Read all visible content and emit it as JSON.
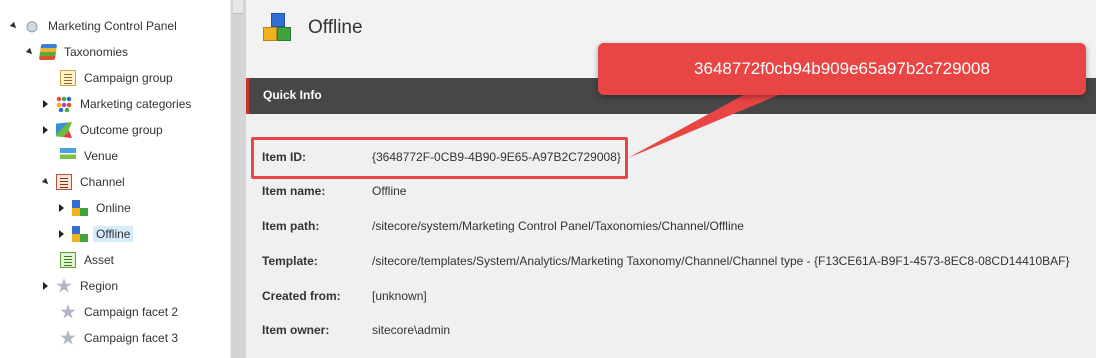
{
  "tree": {
    "items": [
      {
        "label": "Marketing Control Panel",
        "icon": "control-panel-icon"
      },
      {
        "label": "Taxonomies",
        "icon": "books-icon"
      },
      {
        "label": "Campaign group",
        "icon": "document-icon"
      },
      {
        "label": "Marketing categories",
        "icon": "dots-icon"
      },
      {
        "label": "Outcome group",
        "icon": "flag-icon"
      },
      {
        "label": "Venue",
        "icon": "signpost-icon"
      },
      {
        "label": "Channel",
        "icon": "document-icon"
      },
      {
        "label": "Online",
        "icon": "cubes-icon"
      },
      {
        "label": "Offline",
        "icon": "cubes-icon"
      },
      {
        "label": "Asset",
        "icon": "document-icon"
      },
      {
        "label": "Region",
        "icon": "star-icon"
      },
      {
        "label": "Campaign facet 2",
        "icon": "star-icon"
      },
      {
        "label": "Campaign facet 3",
        "icon": "star-icon"
      }
    ],
    "selected": "Offline"
  },
  "item": {
    "title": "Offline",
    "section_title": "Quick Info",
    "fields": [
      {
        "label": "Item ID:",
        "value": "{3648772F-0CB9-4B90-9E65-A97B2C729008}"
      },
      {
        "label": "Item name:",
        "value": "Offline"
      },
      {
        "label": "Item path:",
        "value": "/sitecore/system/Marketing Control Panel/Taxonomies/Channel/Offline"
      },
      {
        "label": "Template:",
        "value": "/sitecore/templates/System/Analytics/Marketing Taxonomy/Channel/Channel type - {F13CE61A-B9F1-4573-8EC8-08CD14410BAF}"
      },
      {
        "label": "Created from:",
        "value": "[unknown]"
      },
      {
        "label": "Item owner:",
        "value": "sitecore\\admin"
      }
    ]
  },
  "callout": {
    "text": "3648772f0cb94b909e65a97b2c729008"
  },
  "colors": {
    "accent_red": "#e84545",
    "quick_info_bar": "#474747",
    "selection": "#d7ecfb"
  }
}
